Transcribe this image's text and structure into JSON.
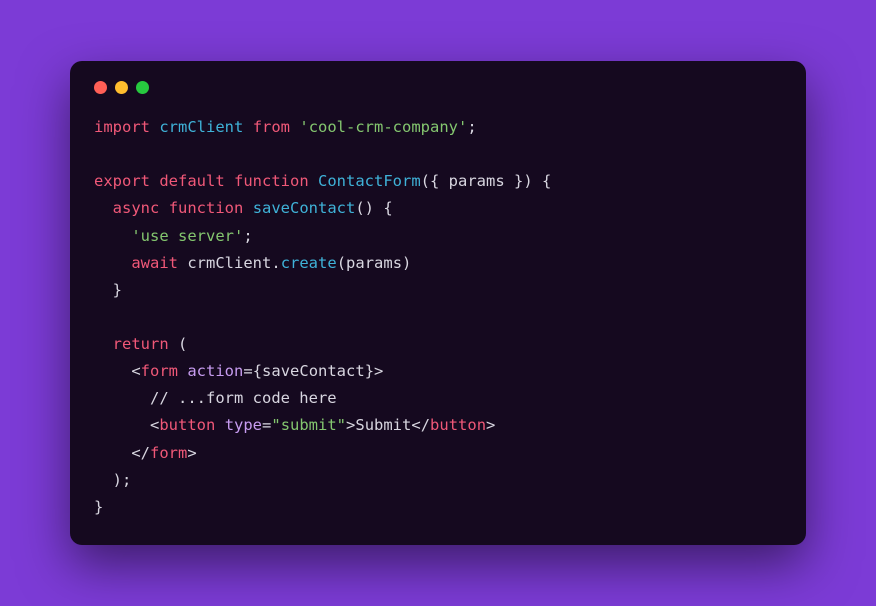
{
  "traffic": {
    "red": "#ff5f56",
    "yellow": "#ffbd2e",
    "green": "#27c93f"
  },
  "code": {
    "l1": {
      "kw_import": "import",
      "id_crm": "crmClient",
      "kw_from": "from",
      "str_pkg": "'cool-crm-company'",
      "semi": ";"
    },
    "blank1": "",
    "l2": {
      "kw_export": "export",
      "kw_default": "default",
      "kw_function": "function",
      "fn_name": "ContactForm",
      "params_open": "({ ",
      "id_params": "params",
      "params_close": " }) {"
    },
    "l3": {
      "indent": "  ",
      "kw_async": "async",
      "kw_function": "function",
      "fn_save": "saveContact",
      "tail": "() {"
    },
    "l4": {
      "indent": "    ",
      "str_use": "'use server'",
      "semi": ";"
    },
    "l5": {
      "indent": "    ",
      "kw_await": "await",
      "id_crm": "crmClient",
      "dot": ".",
      "fn_create": "create",
      "open": "(",
      "id_params": "params",
      "close": ")"
    },
    "l6": {
      "indent": "  ",
      "brace": "}"
    },
    "blank2": "",
    "l7": {
      "indent": "  ",
      "kw_return": "return",
      "open": " ("
    },
    "l8": {
      "indent": "    ",
      "lt": "<",
      "tag_form": "form",
      "sp": " ",
      "attr_action": "action",
      "eq": "=",
      "obrace": "{",
      "id_save": "saveContact",
      "cbrace": "}",
      "gt": ">"
    },
    "l9": {
      "indent": "      ",
      "cmt": "// ...form code here"
    },
    "l10": {
      "indent": "      ",
      "lt": "<",
      "tag_button": "button",
      "sp": " ",
      "attr_type": "type",
      "eq": "=",
      "str_submit": "\"submit\"",
      "gt": ">",
      "text": "Submit",
      "lt2": "</",
      "tag_button2": "button",
      "gt2": ">"
    },
    "l11": {
      "indent": "    ",
      "lt": "</",
      "tag_form": "form",
      "gt": ">"
    },
    "l12": {
      "indent": "  ",
      "close": ");"
    },
    "l13": {
      "brace": "}"
    }
  }
}
